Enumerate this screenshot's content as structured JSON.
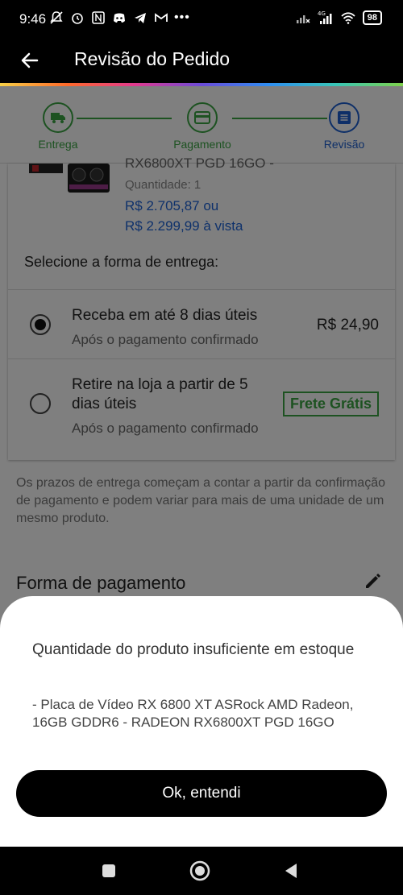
{
  "status_bar": {
    "time": "9:46",
    "battery": "98",
    "network": "4G"
  },
  "app_bar": {
    "title": "Revisão do Pedido"
  },
  "stepper": {
    "steps": [
      {
        "label": "Entrega",
        "state": "done"
      },
      {
        "label": "Pagamento",
        "state": "done"
      },
      {
        "label": "Revisão",
        "state": "active"
      }
    ]
  },
  "product": {
    "name_partial": "RX6800XT PGD 16GO -",
    "quantity": "Quantidade:  1",
    "price_installment": "R$ 2.705,87 ou",
    "price_cash": "R$ 2.299,99 à vista"
  },
  "delivery": {
    "title": "Selecione a forma de entrega:",
    "options": [
      {
        "title": "Receba em até 8 dias úteis",
        "subtitle": "Após o pagamento confirmado",
        "price": "R$ 24,90",
        "selected": true
      },
      {
        "title": "Retire na loja a partir de 5 dias úteis",
        "subtitle": "Após o pagamento confirmado",
        "price": "Frete Grátis",
        "selected": false
      }
    ],
    "disclaimer": "Os prazos de entrega começam a contar a partir da confirmação de pagamento e podem variar para mais de uma unidade de um mesmo produto."
  },
  "payment": {
    "title": "Forma de pagamento"
  },
  "dialog": {
    "title": "Quantidade do produto insuficiente em estoque",
    "message": "- Placa de Vídeo RX 6800 XT ASRock AMD Radeon, 16GB GDDR6 - RADEON RX6800XT PGD 16GO",
    "button": "Ok, entendi"
  },
  "colors": {
    "accent_green": "#3aa543",
    "accent_blue": "#1d5fd0",
    "price_blue": "#1d62d6"
  }
}
